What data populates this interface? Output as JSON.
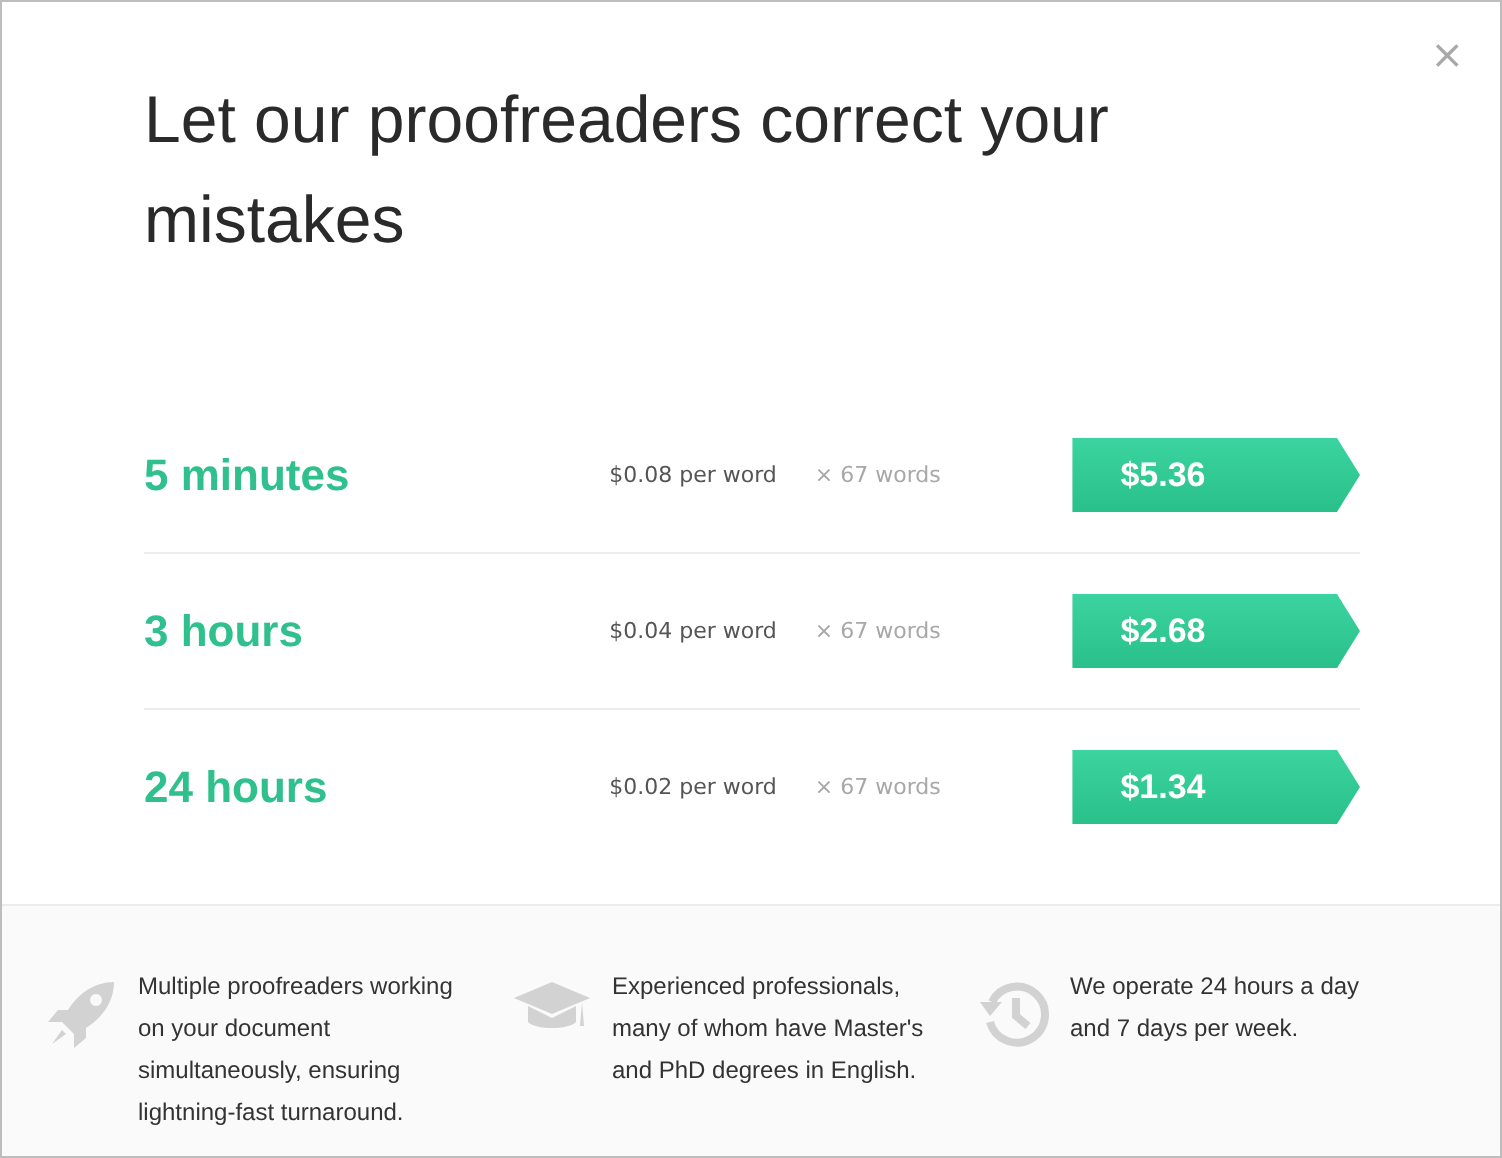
{
  "dialog": {
    "title": "Let our proofreaders correct your mistakes",
    "close": "×"
  },
  "options": [
    {
      "turnaround": "5 minutes",
      "rate": "$0.08 per word",
      "count": "× 67 words",
      "price": "$5.36"
    },
    {
      "turnaround": "3 hours",
      "rate": "$0.04 per word",
      "count": "× 67 words",
      "price": "$2.68"
    },
    {
      "turnaround": "24 hours",
      "rate": "$0.02 per word",
      "count": "× 67 words",
      "price": "$1.34"
    }
  ],
  "features": [
    {
      "kind": "rocket",
      "text": "Multiple proofreaders working on your document simultaneously, ensuring lightning-fast turnaround."
    },
    {
      "kind": "graduation",
      "text": "Experienced professionals, many of whom have Master's and PhD degrees in English."
    },
    {
      "kind": "history",
      "text": "We operate 24 hours a day and 7 days per week."
    }
  ]
}
